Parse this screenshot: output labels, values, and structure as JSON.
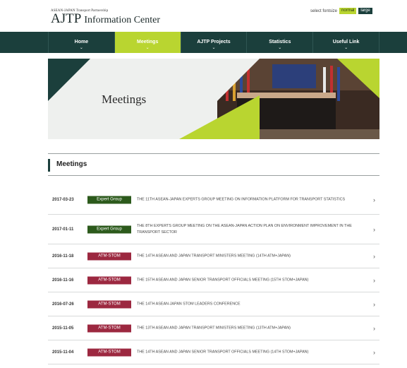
{
  "header": {
    "tagline": "ASEAN-JAPAN Transport Partnership",
    "logo_initials": "AJTP",
    "logo_rest": "Information Center",
    "fontsize_label": "select fontsize",
    "fontsize_normal": "normal",
    "fontsize_large": "large"
  },
  "nav": {
    "items": [
      {
        "label": "Home"
      },
      {
        "label": "Meetings"
      },
      {
        "label": "AJTP Projects"
      },
      {
        "label": "Statistics"
      },
      {
        "label": "Useful Link"
      }
    ],
    "active_index": 1,
    "chevron": "⌄"
  },
  "hero": {
    "title": "Meetings"
  },
  "section": {
    "title": "Meetings"
  },
  "meetings": [
    {
      "date": "2017-03-23",
      "category": "Expert Group",
      "title": "THE 11th ASEAN-JAPAN EXPERTS GROUP MEETING ON INFORMATION PLATFORM FOR TRANSPORT STATISTICS"
    },
    {
      "date": "2017-01-11",
      "category": "Expert Group",
      "title": "THE 8th EXPERTS GROUP MEETING ON THE ASEAN-JAPAN ACTION PLAN ON ENVIRONMENT IMPROVEMENT IN THE TRANSPORT SECTOR"
    },
    {
      "date": "2016-11-18",
      "category": "ATM-STOM",
      "title": "THE 14th ASEAN AND JAPAN TRANSPORT MINISTERS MEETING (14th ATM+Japan)"
    },
    {
      "date": "2016-11-16",
      "category": "ATM-STOM",
      "title": "THE 15th ASEAN AND JAPAN SENIOR TRANSPORT OFFICIALS MEETING (15th STOM+Japan)"
    },
    {
      "date": "2016-07-26",
      "category": "ATM-STOM",
      "title": "THE 14th ASEAN-JAPAN STOM LEADERS CONFERENCE"
    },
    {
      "date": "2015-11-05",
      "category": "ATM-STOM",
      "title": "THE 13th ASEAN AND JAPAN TRANSPORT MINISTERS MEETING (13th ATM+Japan)"
    },
    {
      "date": "2015-11-04",
      "category": "ATM-STOM",
      "title": "THE 14th ASEAN AND JAPAN SENIOR TRANSPORT OFFICIALS MEETING (14th STOM+Japan)"
    }
  ],
  "row_chevron": "›",
  "colors": {
    "nav_bg": "#1b3f3c",
    "accent": "#b9d530",
    "expert_badge": "#2c5a1c",
    "atm_badge": "#9c2840"
  }
}
